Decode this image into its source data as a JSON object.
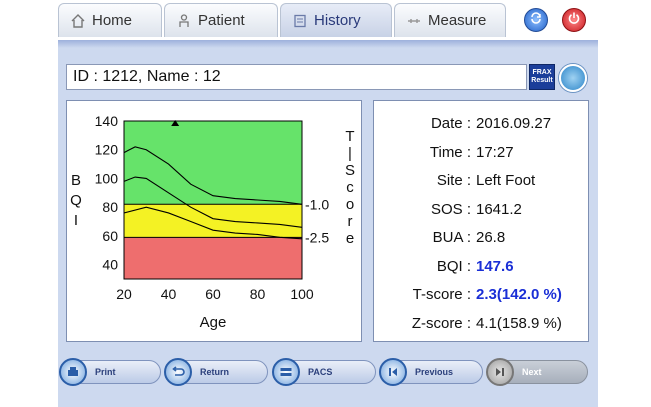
{
  "tabs": [
    {
      "label": "Home",
      "icon": "house-icon"
    },
    {
      "label": "Patient",
      "icon": "person-icon"
    },
    {
      "label": "History",
      "icon": "document-icon"
    },
    {
      "label": "Measure",
      "icon": "ruler-icon"
    }
  ],
  "header_icons": [
    "refresh-icon",
    "power-icon"
  ],
  "patient_bar": {
    "text": "ID : 1212, Name : 12",
    "frax_line1": "FRAX",
    "frax_line2": "Result"
  },
  "chart_data": {
    "type": "line",
    "xlabel": "Age",
    "ylabel": "BQI",
    "right_label": "T-Score",
    "x_ticks": [
      "20",
      "40",
      "60",
      "80",
      "100"
    ],
    "y_ticks": [
      "140",
      "120",
      "100",
      "80",
      "60",
      "40"
    ],
    "xlim": [
      20,
      100
    ],
    "ylim": [
      30,
      140
    ],
    "right_ticks": [
      {
        "label": "-1.0",
        "y": 82
      },
      {
        "label": "-2.5",
        "y": 59
      }
    ],
    "bands": [
      {
        "from": 82,
        "to": 140,
        "color": "#66e36a"
      },
      {
        "from": 59,
        "to": 82,
        "color": "#f4f224"
      },
      {
        "from": 30,
        "to": 59,
        "color": "#ee6e6e"
      }
    ],
    "marker": {
      "x": 43,
      "y": 140
    },
    "series": [
      {
        "values": [
          [
            20,
            118
          ],
          [
            25,
            122
          ],
          [
            30,
            120
          ],
          [
            40,
            110
          ],
          [
            50,
            96
          ],
          [
            60,
            88
          ],
          [
            70,
            86
          ],
          [
            80,
            85
          ],
          [
            90,
            84
          ],
          [
            100,
            82
          ]
        ]
      },
      {
        "values": [
          [
            20,
            98
          ],
          [
            25,
            101
          ],
          [
            30,
            100
          ],
          [
            40,
            90
          ],
          [
            50,
            80
          ],
          [
            60,
            72
          ],
          [
            70,
            70
          ],
          [
            80,
            69
          ],
          [
            90,
            68
          ],
          [
            100,
            66
          ]
        ]
      },
      {
        "values": [
          [
            20,
            76
          ],
          [
            30,
            80
          ],
          [
            40,
            76
          ],
          [
            50,
            70
          ],
          [
            60,
            64
          ],
          [
            70,
            62
          ],
          [
            80,
            61
          ],
          [
            90,
            59
          ],
          [
            100,
            58
          ]
        ]
      }
    ]
  },
  "info": [
    {
      "label": "Date :",
      "value": "2016.09.27",
      "highlight": false
    },
    {
      "label": "Time :",
      "value": "17:27",
      "highlight": false
    },
    {
      "label": "Site :",
      "value": "Left Foot",
      "highlight": false
    },
    {
      "label": "SOS :",
      "value": "1641.2",
      "highlight": false
    },
    {
      "label": "BUA :",
      "value": "26.8",
      "highlight": false
    },
    {
      "label": "BQI :",
      "value": "147.6",
      "highlight": true
    },
    {
      "label": "T-score :",
      "value": "2.3(142.0 %)",
      "highlight": true
    },
    {
      "label": "Z-score :",
      "value": "4.1(158.9 %)",
      "highlight": false
    }
  ],
  "buttons": [
    {
      "label": "Print",
      "icon": "printer-icon",
      "enabled": true
    },
    {
      "label": "Return",
      "icon": "return-arrow-icon",
      "enabled": true
    },
    {
      "label": "PACS",
      "icon": "pacs-icon",
      "enabled": true
    },
    {
      "label": "Previous",
      "icon": "previous-icon",
      "enabled": true
    },
    {
      "label": "Next",
      "icon": "next-icon",
      "enabled": false
    }
  ]
}
